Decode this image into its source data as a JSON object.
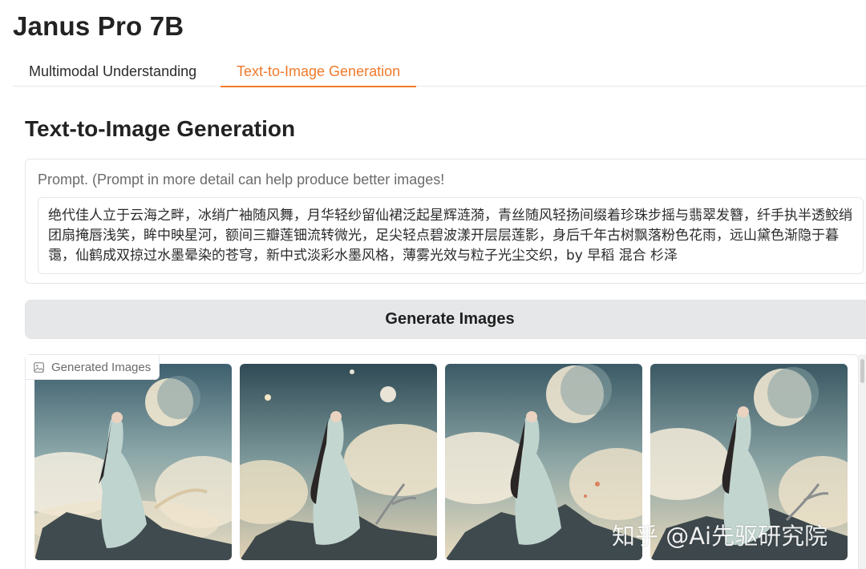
{
  "app": {
    "title": "Janus Pro 7B"
  },
  "tabs": [
    {
      "label": "Multimodal Understanding",
      "active": false
    },
    {
      "label": "Text-to-Image Generation",
      "active": true
    }
  ],
  "colors": {
    "accent": "#f07a2a",
    "button_bg": "#e6e7e9",
    "border": "#e5e7eb"
  },
  "section": {
    "title": "Text-to-Image Generation"
  },
  "prompt": {
    "label": "Prompt. (Prompt in more detail can help produce better images!",
    "value": "绝代佳人立于云海之畔，冰绡广袖随风舞，月华轻纱留仙裙泛起星辉涟漪，青丝随风轻扬间缀着珍珠步摇与翡翠发簪，纤手执半透鲛绡团扇掩唇浅笑，眸中映星河，额间三瓣莲钿流转微光，足尖轻点碧波漾开层层莲影，身后千年古树飘落粉色花雨，远山黛色渐隐于暮霭，仙鹤成双掠过水墨晕染的苍穹，新中式淡彩水墨风格，薄雾光效与粒子光尘交织，by 早稻 混合 杉泽"
  },
  "generate": {
    "label": "Generate Images"
  },
  "gallery": {
    "label": "Generated Images",
    "icon": "image-icon",
    "images": [
      {
        "name": "generated-image-1"
      },
      {
        "name": "generated-image-2"
      },
      {
        "name": "generated-image-3"
      },
      {
        "name": "generated-image-4"
      }
    ]
  },
  "watermark": {
    "text": "知乎 @Ai先驱研究院"
  }
}
